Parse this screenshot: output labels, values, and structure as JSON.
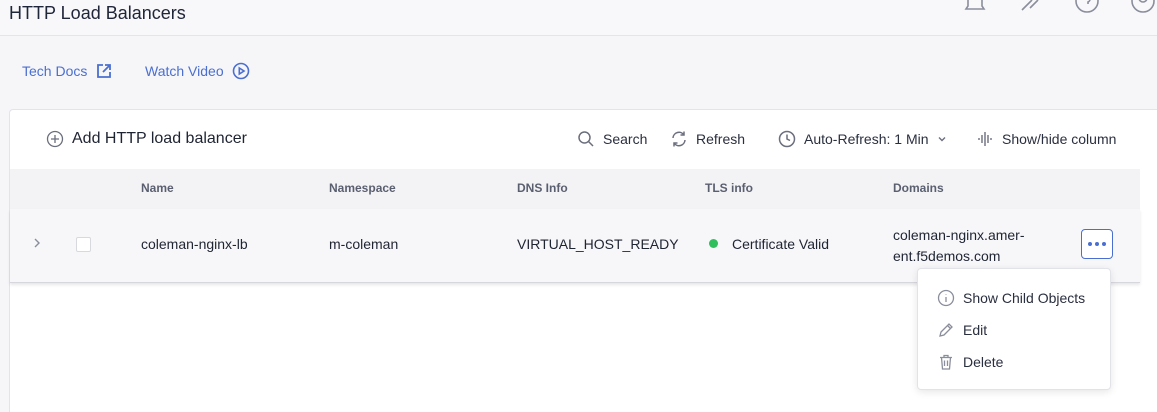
{
  "header": {
    "title": "HTTP Load Balancers",
    "icons": [
      "bell-icon",
      "tools-icon",
      "help-icon",
      "user-icon"
    ]
  },
  "links": {
    "tech_docs": "Tech Docs",
    "tech_docs_icon": "external-link-icon",
    "watch_video": "Watch Video",
    "watch_video_icon": "play-circle-icon"
  },
  "toolbar": {
    "add_label": "Add HTTP load balancer",
    "search_label": "Search",
    "refresh_label": "Refresh",
    "auto_refresh_label": "Auto-Refresh: 1 Min",
    "show_hide_label": "Show/hide column"
  },
  "table": {
    "columns": [
      "Name",
      "Namespace",
      "DNS Info",
      "TLS info",
      "Domains"
    ],
    "rows": [
      {
        "name": "coleman-nginx-lb",
        "namespace": "m-coleman",
        "dns_info": "VIRTUAL_HOST_READY",
        "tls_info": "Certificate Valid",
        "tls_status_color": "#2fbf5c",
        "domains_line1": "coleman-nginx.amer-",
        "domains_line2": "ent.f5demos.com"
      }
    ]
  },
  "row_menu": {
    "items": [
      "Show Child Objects",
      "Edit",
      "Delete"
    ]
  },
  "colors": {
    "accent": "#4a6fd0",
    "success": "#2fbf5c"
  }
}
